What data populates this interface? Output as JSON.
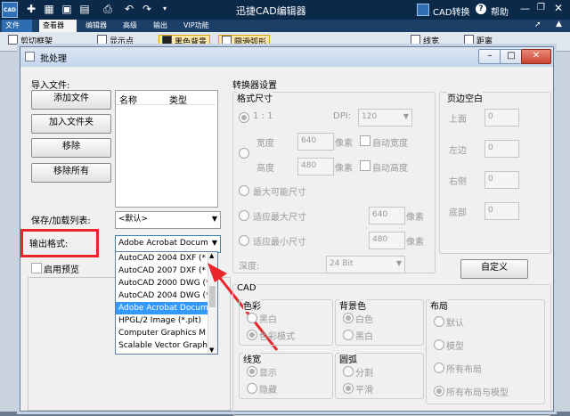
{
  "app": {
    "title": "迅捷CAD编辑器",
    "logo_text": "CAD",
    "convert_label": "CAD转换",
    "help_label": "帮助",
    "colors": {
      "titlebar": "#0b2a4a",
      "accent_red": "#e8262c",
      "selection": "#3399ff"
    }
  },
  "menubar": {
    "items": [
      "文件",
      "查看器",
      "编辑器",
      "高级",
      "输出",
      "VIP功能"
    ]
  },
  "ribbon": {
    "items": [
      "剪切框架",
      "显示点",
      "黑色背景",
      "圆滑弧形",
      "线宽",
      "距离"
    ]
  },
  "dialog": {
    "title": "批处理",
    "import_label": "导入文件:",
    "buttons": {
      "add_file": "添加文件",
      "add_folder": "加入文件夹",
      "remove": "移除",
      "remove_all": "移除所有",
      "custom": "自定义"
    },
    "file_list_headers": [
      "名称",
      "类型"
    ],
    "save_load_label": "保存/加载列表:",
    "save_load_value": "<默认>",
    "output_format_label": "输出格式:",
    "output_format_value": "Adobe Acrobat Docum",
    "preview_label": "启用预览",
    "dropdown_options": [
      "AutoCAD 2004 DXF (*",
      "AutoCAD 2007 DXF (*",
      "AutoCAD 2000 DWG (*",
      "AutoCAD 2004 DWG (*",
      "Adobe Acrobat Docum",
      "HPGL/2 Image (*.plt)",
      "Computer Graphics M",
      "Scalable Vector Graphi"
    ],
    "dropdown_selected_index": 4,
    "converter": {
      "title": "转换器设置",
      "format_size_title": "格式尺寸",
      "ratio_label": "1 : 1",
      "dpi_label": "DPI:",
      "dpi_value": "120",
      "width_label": "宽度",
      "width_value": "640",
      "height_label": "高度",
      "height_value": "480",
      "pixel_unit": "像素",
      "auto_width": "自动宽度",
      "auto_height": "自动高度",
      "max_size": "最大可能尺寸",
      "fit_max": "适应最大尺寸",
      "fit_min": "适应最小尺寸",
      "fit_max_value": "640",
      "fit_min_value": "480",
      "depth_label": "深度:",
      "depth_value": "24 Bit",
      "margin_title": "页边空白",
      "margin_top": "上面",
      "margin_left": "左边",
      "margin_right": "右侧",
      "margin_bottom": "底部",
      "margin_value": "0"
    },
    "cad": {
      "title": "CAD",
      "color_title": "色彩",
      "color_bw": "黑白",
      "color_mode": "色彩模式",
      "bg_title": "背景色",
      "bg_white": "白色",
      "bg_black": "黑白",
      "layout_title": "布局",
      "layout_default": "默认",
      "layout_model": "模型",
      "layout_all": "所有布局",
      "layout_all_model": "所有布局与模型",
      "linewidth_title": "线宽",
      "linewidth_show": "显示",
      "linewidth_hide": "隐藏",
      "arc_title": "圆弧",
      "arc_split": "分割",
      "arc_smooth": "平滑"
    }
  }
}
